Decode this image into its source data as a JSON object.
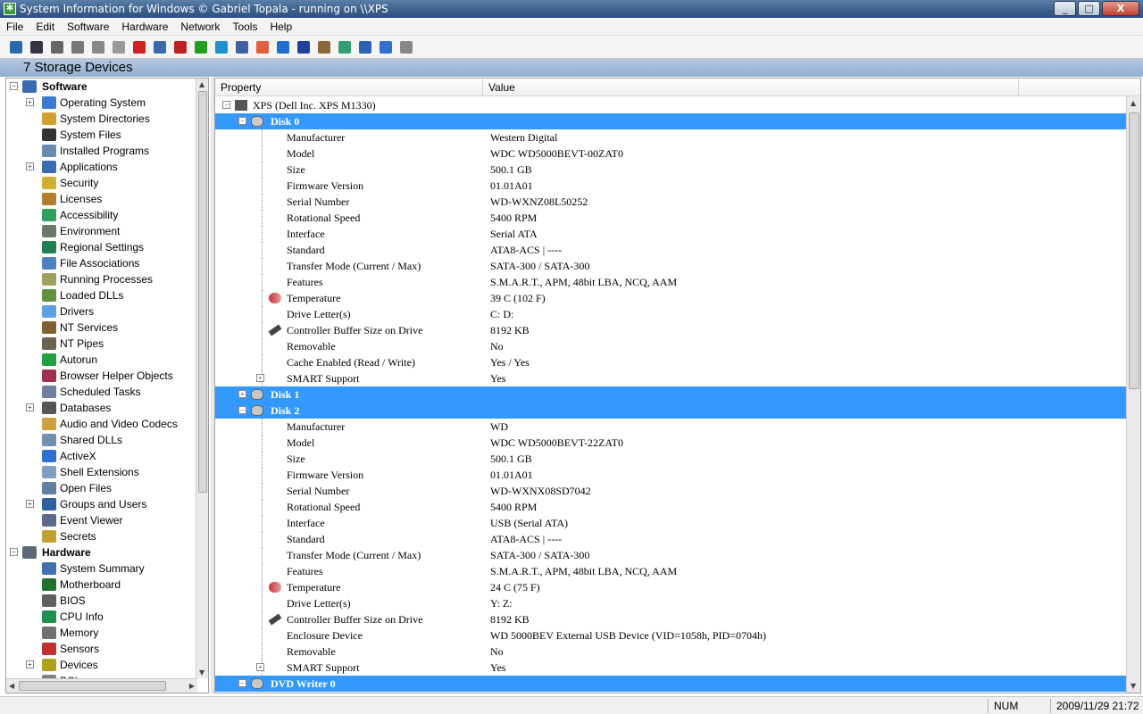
{
  "window": {
    "title": "System Information for Windows  © Gabriel Topala - running on \\\\XPS",
    "minimize": "_",
    "maximize": "□",
    "close": "X"
  },
  "menu": [
    "File",
    "Edit",
    "Software",
    "Hardware",
    "Network",
    "Tools",
    "Help"
  ],
  "toolbar": {
    "icons": [
      "exit-icon",
      "save-icon",
      "cut-icon",
      "copy-icon",
      "paste-icon",
      "print-icon",
      "stop-icon",
      "monitor-icon",
      "color-icon",
      "green-icon",
      "refresh-icon",
      "document-icon",
      "office-icon",
      "globe-icon",
      "shield-icon",
      "cabinet-icon",
      "earth-icon",
      "printer-icon",
      "help-icon",
      "coffee-icon"
    ],
    "colors": [
      "#2a6aa8",
      "#334",
      "#666",
      "#777",
      "#888",
      "#999",
      "#d02020",
      "#3a6aa8",
      "#c02020",
      "#20a020",
      "#2090d0",
      "#4060a0",
      "#e06040",
      "#2070d0",
      "#2040a0",
      "#8a6a3a",
      "#30a070",
      "#3060b0",
      "#3070d0",
      "#888"
    ]
  },
  "caption": "7 Storage Devices",
  "tree": {
    "software_label": "Software",
    "hardware_label": "Hardware",
    "software_items": [
      "Operating System",
      "System Directories",
      "System Files",
      "Installed Programs",
      "Applications",
      "Security",
      "Licenses",
      "Accessibility",
      "Environment",
      "Regional Settings",
      "File Associations",
      "Running Processes",
      "Loaded DLLs",
      "Drivers",
      "NT Services",
      "NT Pipes",
      "Autorun",
      "Browser Helper Objects",
      "Scheduled Tasks",
      "Databases",
      "Audio and Video Codecs",
      "Shared DLLs",
      "ActiveX",
      "Shell Extensions",
      "Open Files",
      "Groups and Users",
      "Event Viewer",
      "Secrets"
    ],
    "hardware_items": [
      "System Summary",
      "Motherboard",
      "BIOS",
      "CPU Info",
      "Memory",
      "Sensors",
      "Devices",
      "PCI"
    ],
    "expandable": [
      "Operating System",
      "Applications",
      "Databases",
      "Groups and Users",
      "Devices"
    ]
  },
  "columns": {
    "property": "Property",
    "value": "Value"
  },
  "root": "XPS (Dell Inc. XPS M1330)",
  "disk0": {
    "title": "Disk 0",
    "rows": [
      [
        "Manufacturer",
        "Western Digital"
      ],
      [
        "Model",
        "WDC WD5000BEVT-00ZAT0"
      ],
      [
        "Size",
        "500.1 GB"
      ],
      [
        "Firmware Version",
        "01.01A01"
      ],
      [
        "Serial Number",
        "WD-WXNZ08L50252"
      ],
      [
        "Rotational Speed",
        "5400 RPM"
      ],
      [
        "Interface",
        "Serial ATA"
      ],
      [
        "Standard",
        "ATA8-ACS | ----"
      ],
      [
        "Transfer Mode (Current / Max)",
        "SATA-300 / SATA-300"
      ],
      [
        "Features",
        "S.M.A.R.T., APM, 48bit LBA, NCQ, AAM"
      ],
      [
        "Temperature",
        "39 C (102 F)"
      ],
      [
        "Drive Letter(s)",
        "C: D:"
      ],
      [
        "Controller Buffer Size on Drive",
        "8192 KB"
      ],
      [
        "Removable",
        "No"
      ],
      [
        "Cache Enabled (Read / Write)",
        "Yes / Yes"
      ],
      [
        "SMART Support",
        "Yes"
      ]
    ]
  },
  "disk1": {
    "title": "Disk 1"
  },
  "disk2": {
    "title": "Disk 2",
    "rows": [
      [
        "Manufacturer",
        "WD"
      ],
      [
        "Model",
        "WDC WD5000BEVT-22ZAT0"
      ],
      [
        "Size",
        "500.1 GB"
      ],
      [
        "Firmware Version",
        "01.01A01"
      ],
      [
        "Serial Number",
        "WD-WXNX08SD7042"
      ],
      [
        "Rotational Speed",
        "5400 RPM"
      ],
      [
        "Interface",
        "USB (Serial ATA)"
      ],
      [
        "Standard",
        "ATA8-ACS | ----"
      ],
      [
        "Transfer Mode (Current / Max)",
        "SATA-300 / SATA-300"
      ],
      [
        "Features",
        "S.M.A.R.T., APM, 48bit LBA, NCQ, AAM"
      ],
      [
        "Temperature",
        "24 C (75 F)"
      ],
      [
        "Drive Letter(s)",
        "Y: Z:"
      ],
      [
        "Controller Buffer Size on Drive",
        "8192 KB"
      ],
      [
        "Enclosure Device",
        "WD 5000BEV External USB Device (VID=1058h, PID=0704h)"
      ],
      [
        "Removable",
        "No"
      ],
      [
        "SMART Support",
        "Yes"
      ]
    ]
  },
  "dvd": {
    "title": "DVD Writer 0"
  },
  "status": {
    "num": "NUM",
    "datetime": "2009/11/29 21:72"
  }
}
